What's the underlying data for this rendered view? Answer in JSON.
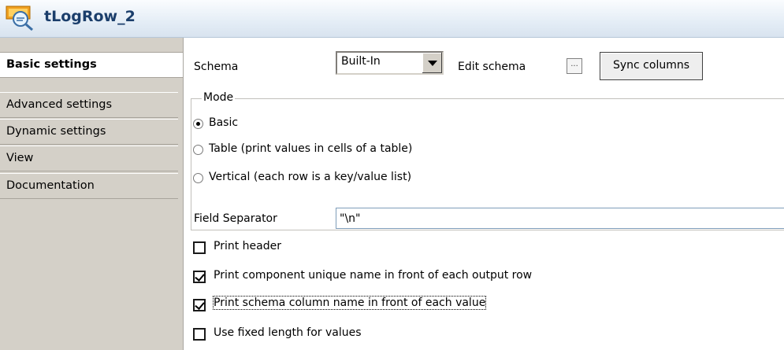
{
  "title": "tLogRow_2",
  "tabs": [
    {
      "label": "Basic settings",
      "active": true
    },
    {
      "label": "Advanced settings",
      "active": false
    },
    {
      "label": "Dynamic settings",
      "active": false
    },
    {
      "label": "View",
      "active": false
    },
    {
      "label": "Documentation",
      "active": false
    }
  ],
  "schema": {
    "label": "Schema",
    "value": "Built-In",
    "edit_label": "Edit schema",
    "dots_label": "...",
    "sync_label": "Sync columns"
  },
  "mode": {
    "legend": "Mode",
    "options": [
      {
        "label": "Basic",
        "selected": true
      },
      {
        "label": "Table (print values in cells of a table)",
        "selected": false
      },
      {
        "label": "Vertical (each row is a key/value list)",
        "selected": false
      }
    ]
  },
  "field_separator": {
    "label": "Field Separator",
    "value": "\"\\n\""
  },
  "checks": [
    {
      "label": "Print header",
      "checked": false
    },
    {
      "label": "Print component unique name in front of each output row",
      "checked": true
    },
    {
      "label": "Print schema column name in front of each value",
      "checked": true
    },
    {
      "label": "Use fixed length for values",
      "checked": false
    }
  ]
}
